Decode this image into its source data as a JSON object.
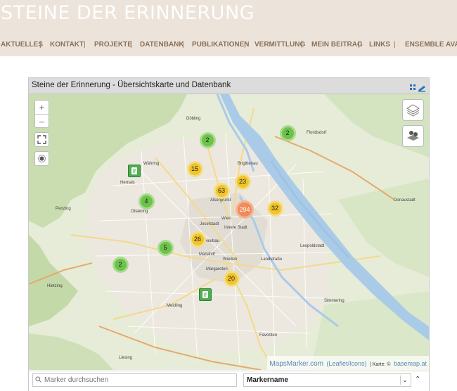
{
  "site": {
    "title": "STEINE DER ERINNERUNG"
  },
  "nav": {
    "items": [
      "AKTUELLES",
      "KONTAKT",
      "PROJEKTE",
      "DATENBANK",
      "PUBLIKATIONEN",
      "VERMITTLUNG",
      "MEIN BEITRAG",
      "LINKS",
      "ENSEMBLE AVANIM"
    ],
    "separator": "|"
  },
  "panel": {
    "title": "Steine der Erinnerung - Übersichtskarte und Datenbank"
  },
  "map": {
    "zoom_in": "+",
    "zoom_out": "–",
    "clusters": [
      {
        "count": "2",
        "color": "green"
      },
      {
        "count": "2",
        "color": "green"
      },
      {
        "count": "15",
        "color": "yellow"
      },
      {
        "count": "63",
        "color": "yellow"
      },
      {
        "count": "23",
        "color": "yellow"
      },
      {
        "count": "294",
        "color": "orange"
      },
      {
        "count": "32",
        "color": "yellow"
      },
      {
        "count": "4",
        "color": "green"
      },
      {
        "count": "26",
        "color": "yellow"
      },
      {
        "count": "5",
        "color": "green"
      },
      {
        "count": "2",
        "color": "green"
      },
      {
        "count": "20",
        "color": "yellow"
      }
    ],
    "places": [
      "Döbling",
      "Währing",
      "Hernals",
      "Ottakring",
      "Penzing",
      "Hietzing",
      "Meidling",
      "Liesing",
      "Brigittenau",
      "Alsergrund",
      "Wien",
      "Innere Stadt",
      "Josefstadt",
      "Neubau",
      "Mariahilf",
      "Margareten",
      "Wieden",
      "Landstraße",
      "Leopoldstadt",
      "Simmering",
      "Favoriten",
      "Donaustadt",
      "Floridsdorf"
    ],
    "attribution": {
      "brand": "MapsMarker.com",
      "leaflet": "(Leaflet/Icons)",
      "karte": "| Karte: ©",
      "basemap": "basemap.at"
    }
  },
  "search": {
    "placeholder": "Marker durchsuchen",
    "select_value": "Markername",
    "chevron": "⌄",
    "up": "⌃"
  },
  "colors": {
    "header_bg": "#ece4db",
    "nav_text": "#8a6f57",
    "cluster_green": "#6cc24a",
    "cluster_yellow": "#f0c42a",
    "cluster_orange": "#f08a5a"
  }
}
